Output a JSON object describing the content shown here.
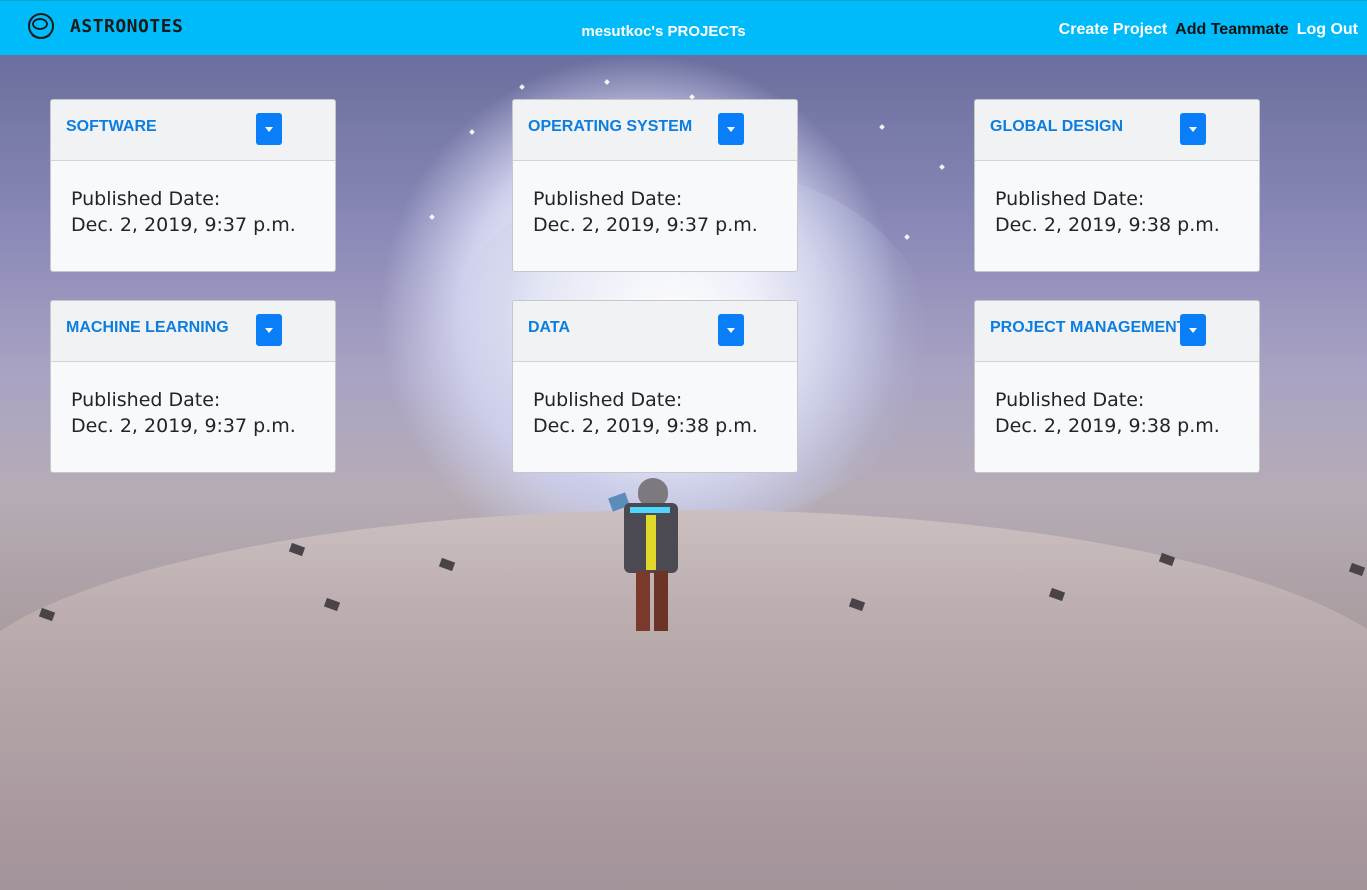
{
  "navbar": {
    "brand": "ASTRONOTES",
    "brand_icon": "astronaut-helmet-icon",
    "title": "mesutkoc's PROJECTs",
    "links": [
      "Create Project",
      "Add Teammate",
      "Log Out"
    ]
  },
  "projects": [
    {
      "name": "SOFTWARE",
      "label": "Published Date:",
      "date": "Dec. 2, 2019, 9:37 p.m."
    },
    {
      "name": "OPERATING SYSTEM",
      "label": "Published Date:",
      "date": "Dec. 2, 2019, 9:37 p.m."
    },
    {
      "name": "GLOBAL DESIGN",
      "label": "Published Date:",
      "date": "Dec. 2, 2019, 9:38 p.m."
    },
    {
      "name": "MACHINE LEARNING",
      "label": "Published Date:",
      "date": "Dec. 2, 2019, 9:37 p.m."
    },
    {
      "name": "DATA",
      "label": "Published Date:",
      "date": "Dec. 2, 2019, 9:38 p.m."
    },
    {
      "name": "PROJECT MANAGEMENT",
      "label": "Published Date:",
      "date": "Dec. 2, 2019, 9:38 p.m."
    }
  ],
  "colors": {
    "navbar": "#00bbf9",
    "card_title": "#0d7ee0",
    "dropdown_button": "#0a7df8"
  }
}
